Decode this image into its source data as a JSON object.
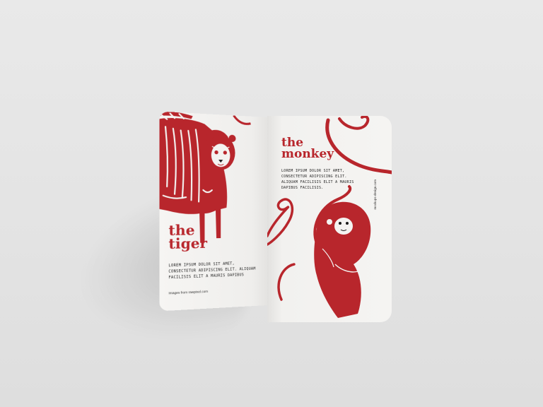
{
  "booklet": {
    "left_page": {
      "title_line1": "the",
      "title_line2": "tiger",
      "body": "LOREM IPSUM DOLOR SIT AMET, CONSECTETUR ADIPISCING ELIT. ALIQUAM FACILISIS ELIT A MAURIS DAPIBUS",
      "credit": "Images from rawpixel.com",
      "illustration": "tiger-illustration"
    },
    "right_page": {
      "title_line1": "the",
      "title_line2": "monkey",
      "body": "LOREM IPSUM DOLOR SIT AMET, CONSECTETUR ADIPISCING ELIT. ALIQUAM FACILISIS ELIT A MAURIS DAPIBUS FACILISIS.",
      "vertical_text": "mockups-design.com",
      "illustration": "monkey-illustration"
    }
  },
  "colors": {
    "accent_red": "#b8262c",
    "paper": "#f4f3f1",
    "background": "#e5e5e5"
  }
}
